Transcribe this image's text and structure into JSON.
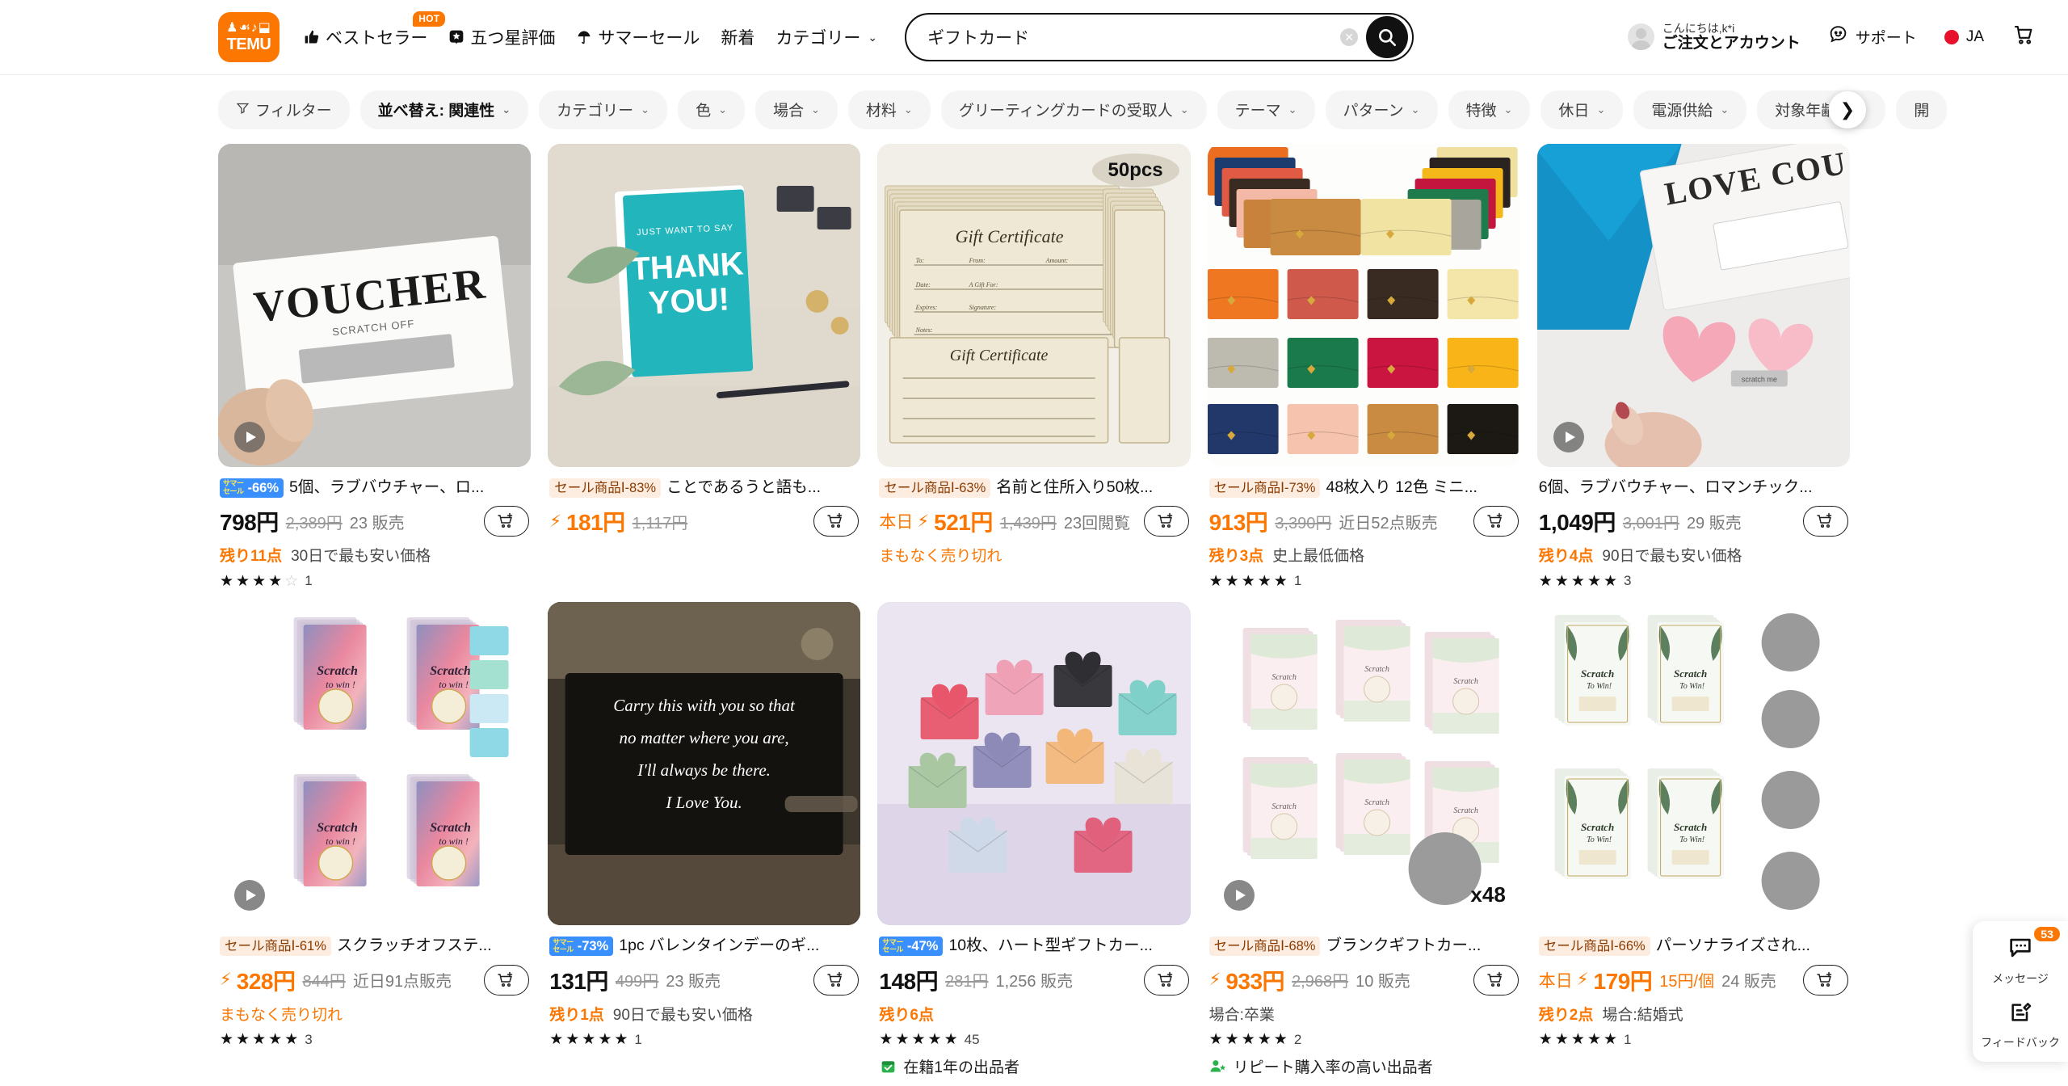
{
  "header": {
    "logo_glyphs": "♟☙♪⬓",
    "logo_text": "TEMU",
    "nav": [
      {
        "icon": "thumbs-up",
        "label": "ベストセラー",
        "badge": "HOT"
      },
      {
        "icon": "star-square",
        "label": "五つ星評価",
        "badge": ""
      },
      {
        "icon": "parasol",
        "label": "サマーセール",
        "badge": ""
      },
      {
        "icon": "",
        "label": "新着",
        "badge": ""
      },
      {
        "icon": "",
        "label": "カテゴリー",
        "badge": "",
        "chevron": "⌄"
      }
    ],
    "search": {
      "value": "ギフトカード",
      "placeholder": "検索"
    },
    "account": {
      "greeting": "こんにちは,k*i",
      "label": "ご注文とアカウント"
    },
    "support_label": "サポート",
    "language": "JA",
    "cart_label": "cart"
  },
  "filters": {
    "filter_label": "フィルター",
    "chips": [
      {
        "label": "並べ替え: 関連性",
        "chevron": "⌄",
        "strong": true
      },
      {
        "label": "カテゴリー",
        "chevron": "⌄"
      },
      {
        "label": "色",
        "chevron": "⌄"
      },
      {
        "label": "場合",
        "chevron": "⌄"
      },
      {
        "label": "材料",
        "chevron": "⌄"
      },
      {
        "label": "グリーティングカードの受取人",
        "chevron": "⌄"
      },
      {
        "label": "テーマ",
        "chevron": "⌄"
      },
      {
        "label": "パターン",
        "chevron": "⌄"
      },
      {
        "label": "特徴",
        "chevron": "⌄"
      },
      {
        "label": "休日",
        "chevron": "⌄"
      },
      {
        "label": "電源供給",
        "chevron": "⌄"
      },
      {
        "label": "対象年齢層",
        "chevron": "⌄"
      },
      {
        "label": "開",
        "chevron": ""
      }
    ],
    "next_arrow": "❯"
  },
  "products": [
    {
      "art": "img-voucher",
      "has_video": true,
      "tag_type": "summer",
      "tag_text": "サマーセール",
      "tag_pct": "-66%",
      "title": "5個、ラブバウチャー、ロ...",
      "price": "798円",
      "price_orange": false,
      "today": "",
      "bolt": false,
      "old_price": "2,389円",
      "sold": "23 販売",
      "stock": "残り11点",
      "note": "30日で最も安い価格",
      "stars": 4,
      "empty_stars": 1,
      "rating_count": "1",
      "seller_badge": "",
      "seller_icon": ""
    },
    {
      "art": "img-thankyou",
      "has_video": false,
      "tag_type": "sale",
      "tag_text": "セール商品Ⅰ",
      "tag_pct": "-83%",
      "title": "ことであるうと語も...",
      "price": "181円",
      "price_orange": true,
      "today": "",
      "bolt": true,
      "old_price": "1,117円",
      "sold": "",
      "stock": "",
      "note": "",
      "stars": 0,
      "empty_stars": 0,
      "rating_count": "",
      "seller_badge": "",
      "seller_icon": ""
    },
    {
      "art": "img-cert",
      "has_video": false,
      "pcs_badge": "50pcs",
      "tag_type": "sale",
      "tag_text": "セール商品Ⅰ",
      "tag_pct": "-63%",
      "title": "名前と住所入り50枚...",
      "price": "521円",
      "price_orange": true,
      "today": "本日",
      "bolt": true,
      "old_price": "1,439円",
      "sold": "23回閲覧",
      "stock": "",
      "soldout": "まもなく売り切れ",
      "note": "",
      "stars": 0,
      "empty_stars": 0,
      "rating_count": "",
      "seller_badge": "",
      "seller_icon": ""
    },
    {
      "art": "img-envelopes",
      "has_video": false,
      "tag_type": "sale",
      "tag_text": "セール商品Ⅰ",
      "tag_pct": "-73%",
      "title": "48枚入り 12色 ミニ...",
      "price": "913円",
      "price_orange": true,
      "today": "",
      "bolt": false,
      "old_price": "3,390円",
      "sold": "近日52点販売",
      "stock": "残り3点",
      "note": "史上最低価格",
      "stars": 5,
      "empty_stars": 0,
      "rating_count": "1",
      "seller_badge": "",
      "seller_icon": ""
    },
    {
      "art": "img-lovecou",
      "has_video": true,
      "tag_type": "none",
      "tag_text": "",
      "tag_pct": "",
      "title": "6個、ラブバウチャー、ロマンチック...",
      "price": "1,049円",
      "price_orange": false,
      "today": "",
      "bolt": false,
      "old_price": "3,001円",
      "sold": "29 販売",
      "stock": "残り4点",
      "note": "90日で最も安い価格",
      "stars": 5,
      "empty_stars": 0,
      "rating_count": "3",
      "seller_badge": "",
      "seller_icon": ""
    },
    {
      "art": "img-scratch1",
      "has_video": true,
      "tag_type": "sale",
      "tag_text": "セール商品Ⅰ",
      "tag_pct": "-61%",
      "title": "スクラッチオフステ...",
      "price": "328円",
      "price_orange": true,
      "today": "",
      "bolt": true,
      "old_price": "844円",
      "sold": "近日91点販売",
      "stock": "",
      "soldout": "まもなく売り切れ",
      "note": "",
      "stars": 5,
      "empty_stars": 0,
      "rating_count": "3",
      "seller_badge": "",
      "seller_icon": ""
    },
    {
      "art": "img-carry",
      "has_video": false,
      "tag_type": "summer",
      "tag_text": "サマーセール",
      "tag_pct": "-73%",
      "title": "1pc バレンタインデーのギ...",
      "price": "131円",
      "price_orange": false,
      "today": "",
      "bolt": false,
      "old_price": "499円",
      "sold": "23 販売",
      "stock": "残り1点",
      "note": "90日で最も安い価格",
      "stars": 5,
      "empty_stars": 0,
      "rating_count": "1",
      "seller_badge": "",
      "seller_icon": ""
    },
    {
      "art": "img-hearts",
      "has_video": false,
      "tag_type": "summer",
      "tag_text": "サマーセール",
      "tag_pct": "-47%",
      "title": "10枚、ハート型ギフトカー...",
      "price": "148円",
      "price_orange": false,
      "today": "",
      "bolt": false,
      "old_price": "281円",
      "sold": "1,256 販売",
      "stock": "残り6点",
      "note": "",
      "stars": 5,
      "empty_stars": 0,
      "rating_count": "45",
      "seller_badge": "在籍1年の出品者",
      "seller_icon": "calendar-check"
    },
    {
      "art": "img-blank",
      "has_video": true,
      "x48_badge": "x48",
      "tag_type": "sale",
      "tag_text": "セール商品Ⅰ",
      "tag_pct": "-68%",
      "title": "ブランクギフトカー...",
      "price": "933円",
      "price_orange": true,
      "today": "",
      "bolt": true,
      "old_price": "2,968円",
      "sold": "10 販売",
      "stock": "",
      "note": "場合:卒業",
      "stars": 5,
      "empty_stars": 0,
      "rating_count": "2",
      "seller_badge": "リピート購入率の高い出品者",
      "seller_icon": "user-star"
    },
    {
      "art": "img-personal",
      "has_video": false,
      "tag_type": "sale",
      "tag_text": "セール商品Ⅰ",
      "tag_pct": "-66%",
      "title": "パーソナライズされ...",
      "price": "179円",
      "price_orange": true,
      "today": "本日",
      "bolt": true,
      "old_price": "",
      "unit_price": "15円/個",
      "sold": "24 販売",
      "stock": "残り2点",
      "note": "場合:結婚式",
      "stars": 5,
      "empty_stars": 0,
      "rating_count": "1",
      "seller_badge": "",
      "seller_icon": ""
    }
  ],
  "float_panel": {
    "message_label": "メッセージ",
    "message_count": "53",
    "feedback_label": "フィードバック"
  },
  "colors": {
    "brand_orange": "#fb7701",
    "summer_blue": "#3a8fff",
    "sale_tag_bg": "#fdece0",
    "sale_tag_text": "#8a3b00"
  }
}
